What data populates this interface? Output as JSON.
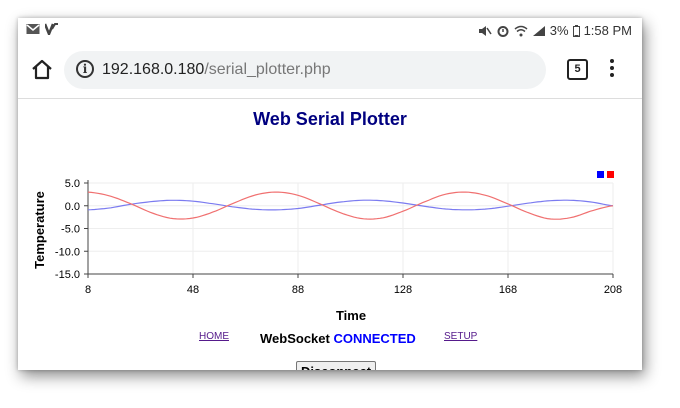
{
  "status_bar": {
    "left_icons": [
      "gmail-icon",
      "v-app-icon"
    ],
    "battery": "3%",
    "time": "1:58 PM"
  },
  "browser": {
    "url_host": "192.168.0.180",
    "url_path": "/serial_plotter.php",
    "tab_count": "5"
  },
  "page": {
    "title": "Web Serial Plotter",
    "nav_home": "HOME",
    "nav_setup": "SETUP",
    "ws_label": "WebSocket",
    "ws_state": "CONNECTED",
    "disconnect_label": "Disconnect"
  },
  "chart_data": {
    "type": "line",
    "title": "",
    "xlabel": "Time",
    "ylabel": "Temperature",
    "xlim": [
      8,
      208
    ],
    "ylim": [
      -15,
      5
    ],
    "xticks": [
      8,
      48,
      88,
      128,
      168,
      208
    ],
    "yticks": [
      5.0,
      0.0,
      -5.0,
      -10.0,
      -15.0
    ],
    "ytick_labels": [
      "5.0",
      "0.0",
      "-5.0",
      "-10.0",
      "-15.0"
    ],
    "grid": true,
    "legend": "top-right",
    "series": [
      {
        "color": "#0000ff",
        "stroke": "#7b7bf0",
        "x": [
          8,
          16,
          24,
          32,
          40,
          48,
          56,
          64,
          72,
          80,
          88,
          96,
          104,
          112,
          120,
          128,
          136,
          144,
          152,
          160,
          168,
          176,
          184,
          192,
          200,
          208
        ],
        "y": [
          -0.9,
          -0.5,
          0.3,
          0.9,
          1.2,
          1.0,
          0.4,
          -0.3,
          -0.8,
          -0.9,
          -0.6,
          0.1,
          0.8,
          1.2,
          1.1,
          0.6,
          -0.1,
          -0.7,
          -0.9,
          -0.7,
          -0.1,
          0.6,
          1.1,
          1.2,
          0.8,
          0.0
        ]
      },
      {
        "color": "#ff0000",
        "stroke": "#f07070",
        "x": [
          8,
          16,
          24,
          32,
          40,
          48,
          56,
          64,
          72,
          80,
          88,
          96,
          104,
          112,
          120,
          128,
          136,
          144,
          152,
          160,
          168,
          176,
          184,
          192,
          200,
          208
        ],
        "y": [
          3.0,
          2.2,
          0.5,
          -1.5,
          -2.8,
          -2.7,
          -1.3,
          0.7,
          2.4,
          3.0,
          2.3,
          0.5,
          -1.5,
          -2.8,
          -2.7,
          -1.2,
          0.8,
          2.5,
          3.0,
          2.2,
          0.4,
          -1.6,
          -2.9,
          -2.6,
          -1.1,
          0.0
        ]
      }
    ]
  }
}
